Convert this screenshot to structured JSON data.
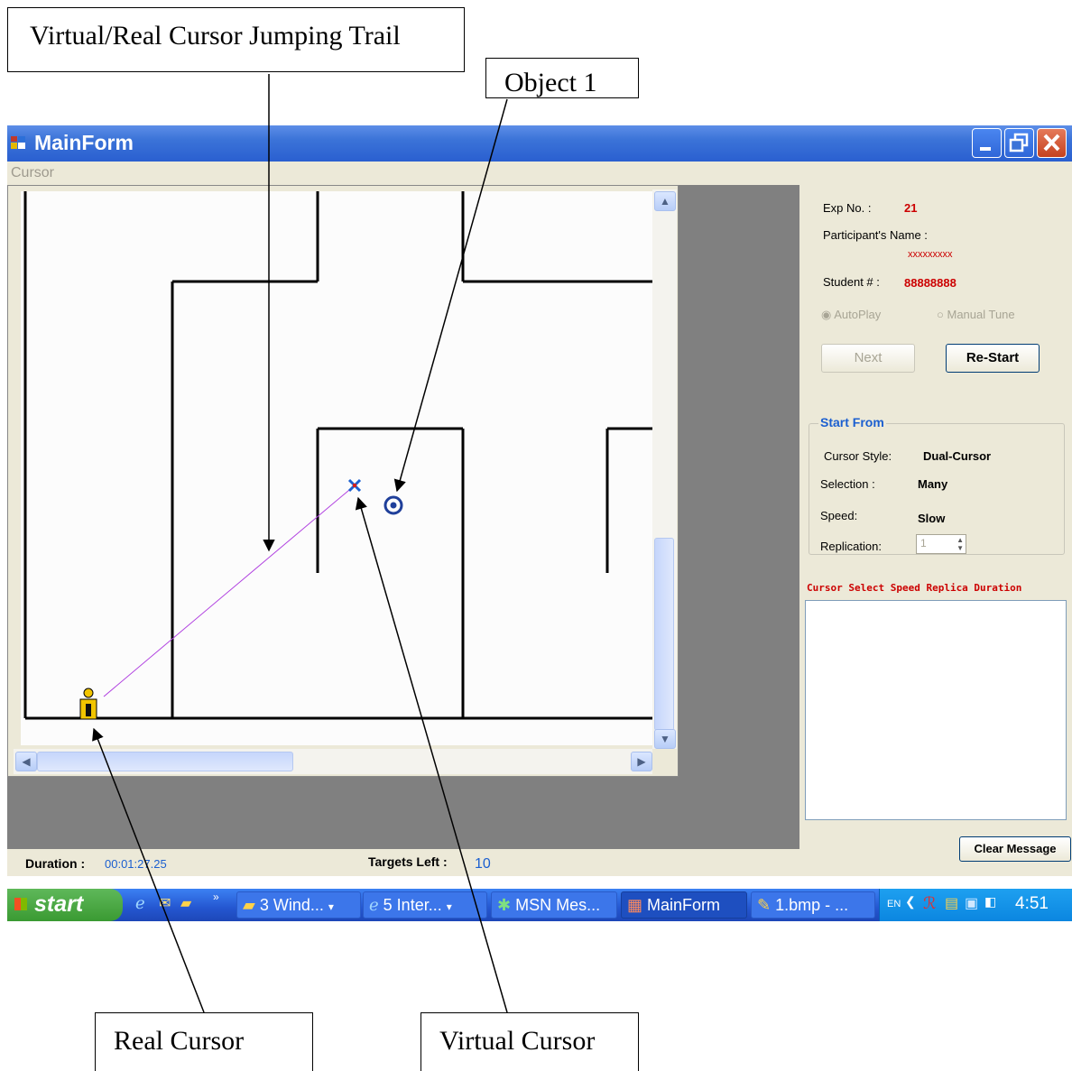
{
  "callouts": {
    "trail": "Virtual/Real Cursor Jumping Trail",
    "object1": "Object 1",
    "real_cursor": "Real Cursor",
    "virtual_cursor": "Virtual Cursor"
  },
  "window": {
    "title": "MainForm",
    "menu": [
      "Cursor"
    ]
  },
  "panel": {
    "exp_label": "Exp No. :",
    "exp_value": "21",
    "participant_label": "Participant's Name :",
    "participant_value": "xxxxxxxxx",
    "student_label": "Student # :",
    "student_value": "88888888",
    "radio_autoplay": "AutoPlay",
    "radio_manual": "Manual Tune",
    "next_label": "Next",
    "restart_label": "Re-Start",
    "group_title": "Start From",
    "cursor_style_label": "Cursor Style:",
    "cursor_style_value": "Dual-Cursor",
    "selection_label": "Selection :",
    "selection_value": "Many",
    "speed_label": "Speed:",
    "speed_value": "Slow",
    "replication_label": "Replication:",
    "replication_value": "1",
    "log_header": "Cursor Select Speed Replica Duration",
    "clear_label": "Clear Message"
  },
  "status": {
    "duration_label": "Duration :",
    "duration_value": "00:01:27.25",
    "targets_label": "Targets Left :",
    "targets_value": "10"
  },
  "taskbar": {
    "start": "start",
    "items": [
      "3 Wind...",
      "5 Inter...",
      "MSN Mes...",
      "MainForm",
      "1.bmp - ..."
    ],
    "lang": "EN",
    "clock": "4:51"
  },
  "colors": {
    "accent_red": "#cc0000",
    "accent_blue": "#1b5fd0",
    "trail": "#b040e0"
  }
}
